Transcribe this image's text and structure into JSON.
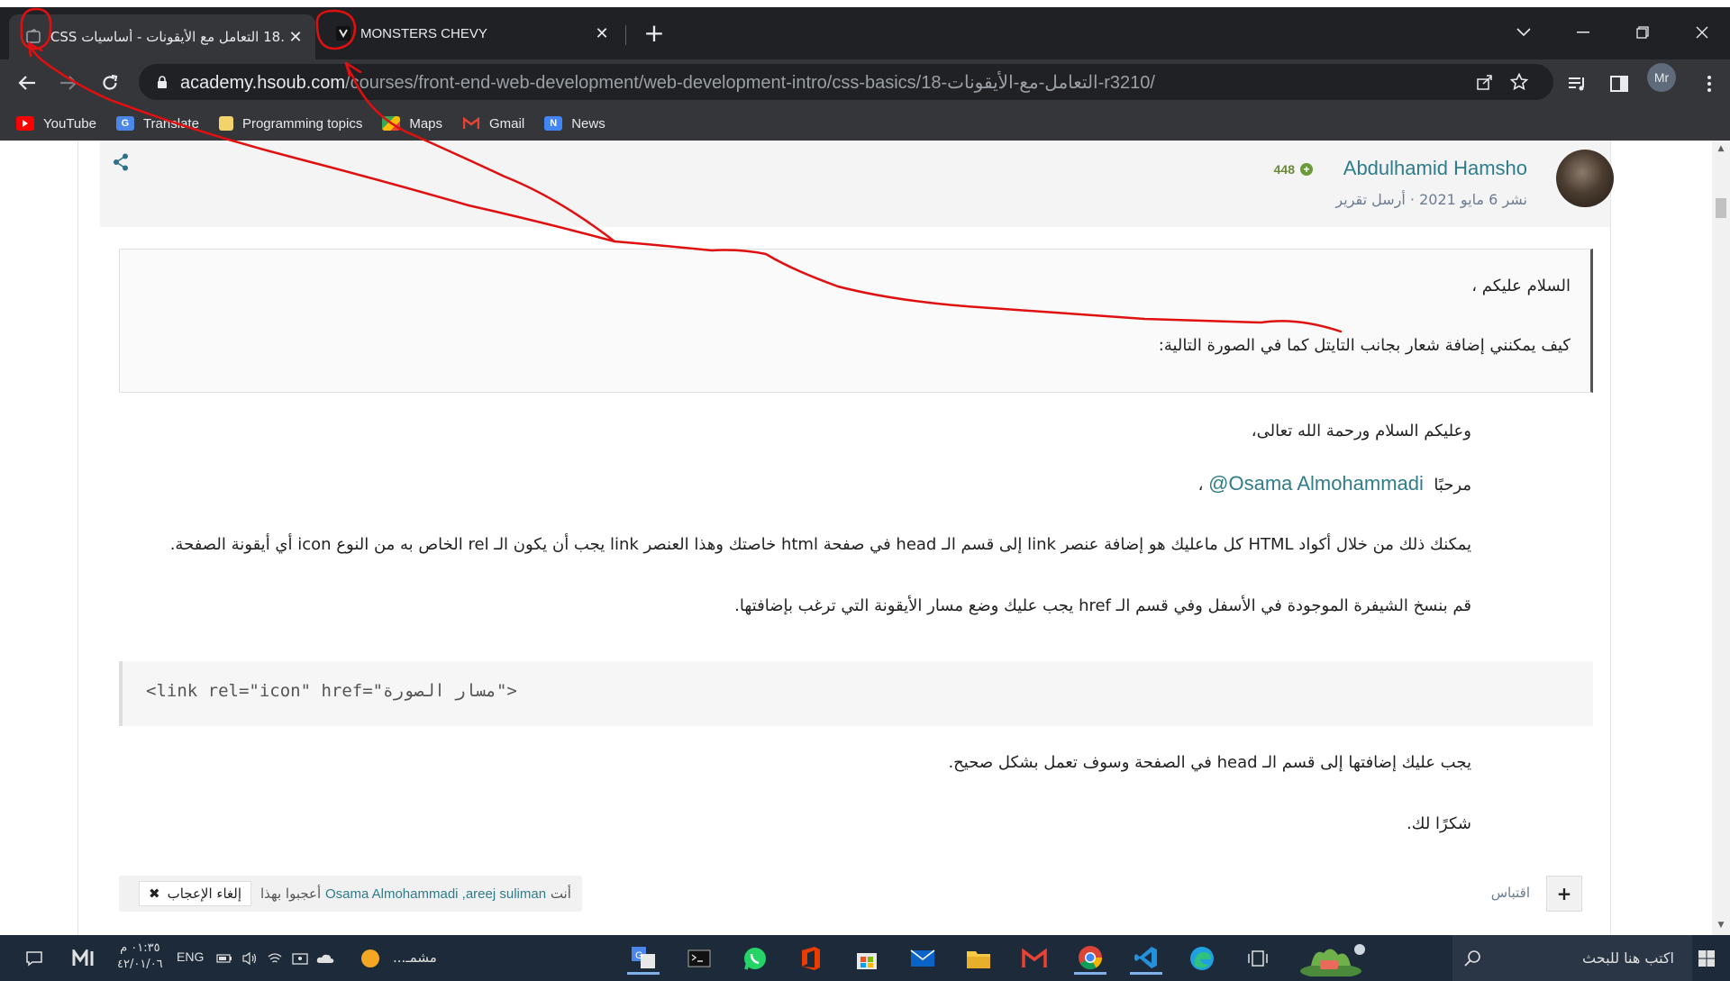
{
  "browser": {
    "tabs": [
      {
        "title": ".18 التعامل مع الأيقونات - أساسيات CSS",
        "active": true
      },
      {
        "title": "MONSTERS CHEVY",
        "active": false
      }
    ],
    "url_host": "academy.hsoub.com",
    "url_path": "/courses/front-end-web-development/web-development-intro/css-basics/18-التعامل-مع-الأيقونات-r3210/",
    "profile_initials": "Mr",
    "bookmarks": [
      "YouTube",
      "Translate",
      "Programming topics",
      "Maps",
      "Gmail",
      "News"
    ]
  },
  "post": {
    "author_name": "Abdulhamid Hamsho",
    "author_reputation": "448",
    "meta": "نشر 6 مايو 2021 · أرسل تقرير",
    "quote_line1": "السلام عليكم ،",
    "quote_line2": "كيف يمكنني إضافة شعار بجانب التايتل كما في الصورة التالية:",
    "greeting": "وعليكم السلام ورحمة الله تعالى،",
    "hello_prefix": "مرحبًا",
    "mention": "@Osama Almohammadi",
    "hello_suffix": "،",
    "paragraph1": "يمكنك ذلك من خلال أكواد HTML كل ماعليك هو إضافة عنصر link إلى قسم الـ head في صفحة html خاصتك وهذا العنصر link يجب أن يكون الـ rel الخاص به من النوع icon أي أيقونة الصفحة.",
    "paragraph2": "قم بنسخ الشيفرة الموجودة في الأسفل وفي قسم الـ href يجب عليك وضع مسار الأيقونة التي ترغب بإضافتها.",
    "code": "<link rel=\"icon\" href=\"مسار الصورة\">",
    "paragraph3": "يجب عليك إضافتها إلى قسم الـ head في الصفحة وسوف تعمل بشكل صحيح.",
    "thanks": "شكرًا لك.",
    "reactions_prefix": "أنت",
    "reactions_names": "Osama Almohammadi ,areej suliman",
    "reactions_suffix": "أعجبوا بهذا",
    "unlike_label": "إلغاء الإعجاب",
    "quote_label": "اقتباس"
  },
  "taskbar": {
    "search_placeholder": "اكتب هنا للبحث",
    "time": "٠١:٣٥ م",
    "date": "٤٢/٠١/٠٦",
    "language": "ENG",
    "running_app_label": "مشمـ..."
  },
  "colors": {
    "accent_link": "#2f7c8a",
    "annotation_red": "#e01010",
    "chrome_dark": "#202124",
    "taskbar_bg": "#1c2a3a"
  }
}
